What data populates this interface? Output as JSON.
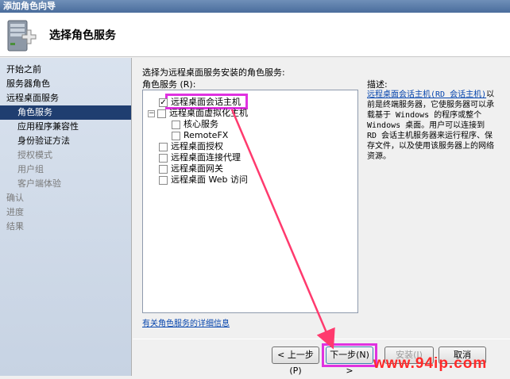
{
  "window": {
    "title": "添加角色向导"
  },
  "header": {
    "page_title": "选择角色服务",
    "icon": "server-wizard-icon"
  },
  "nav": {
    "items": [
      {
        "label": "开始之前",
        "sub": false,
        "dim": false,
        "selected": false
      },
      {
        "label": "服务器角色",
        "sub": false,
        "dim": false,
        "selected": false
      },
      {
        "label": "远程桌面服务",
        "sub": false,
        "dim": false,
        "selected": false
      },
      {
        "label": "角色服务",
        "sub": true,
        "dim": false,
        "selected": true
      },
      {
        "label": "应用程序兼容性",
        "sub": true,
        "dim": false,
        "selected": false
      },
      {
        "label": "身份验证方法",
        "sub": true,
        "dim": false,
        "selected": false
      },
      {
        "label": "授权模式",
        "sub": true,
        "dim": true,
        "selected": false
      },
      {
        "label": "用户组",
        "sub": true,
        "dim": true,
        "selected": false
      },
      {
        "label": "客户端体验",
        "sub": true,
        "dim": true,
        "selected": false
      },
      {
        "label": "确认",
        "sub": false,
        "dim": true,
        "selected": false
      },
      {
        "label": "进度",
        "sub": false,
        "dim": true,
        "selected": false
      },
      {
        "label": "结果",
        "sub": false,
        "dim": true,
        "selected": false
      }
    ]
  },
  "main": {
    "instruction": "选择为远程桌面服务安装的角色服务:",
    "services_label": "角色服务 (R):",
    "services": [
      {
        "label": "远程桌面会话主机",
        "checked": true,
        "indent": 1
      },
      {
        "label": "远程桌面虚拟化主机",
        "checked": false,
        "indent": 0,
        "expander": "⊟"
      },
      {
        "label": "核心服务",
        "checked": false,
        "indent": 2
      },
      {
        "label": "RemoteFX",
        "checked": false,
        "indent": 2
      },
      {
        "label": "远程桌面授权",
        "checked": false,
        "indent": 1
      },
      {
        "label": "远程桌面连接代理",
        "checked": false,
        "indent": 1
      },
      {
        "label": "远程桌面网关",
        "checked": false,
        "indent": 1
      },
      {
        "label": "远程桌面 Web 访问",
        "checked": false,
        "indent": 1
      }
    ],
    "details_link": "有关角色服务的详细信息",
    "description": {
      "title": "描述:",
      "link": "远程桌面会话主机(RD 会话主机)",
      "text": "以前是终端服务器，它使服务器可以承载基于 Windows 的程序或整个 Windows 桌面。用户可以连接到 RD 会话主机服务器来运行程序、保存文件，以及使用该服务器上的网络资源。"
    }
  },
  "buttons": {
    "prev": "< 上一步(P)",
    "next": "下一步(N) >",
    "install": "安装(I)",
    "cancel": "取消"
  },
  "annotation": {
    "color": "#e032e0",
    "arrow_color": "#ff3a6e"
  },
  "watermark": "www.94ip.com"
}
